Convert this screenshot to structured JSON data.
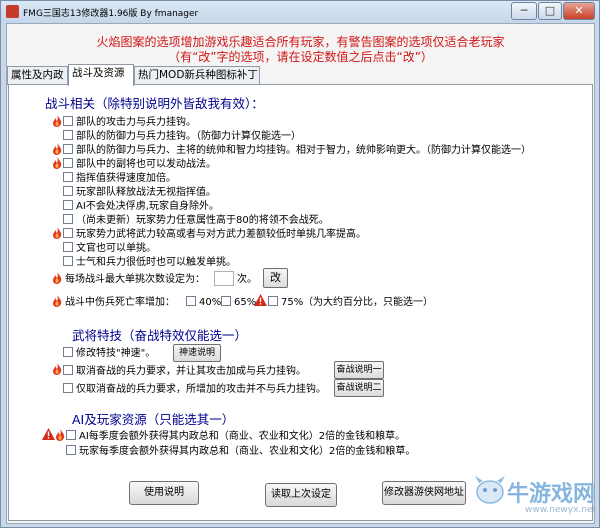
{
  "window": {
    "title": "FMG三国志13修改器1.96版 By fmanager",
    "min": "─",
    "max": "□",
    "close": "✕"
  },
  "warning": {
    "line1": "火焰图案的选项增加游戏乐趣适合所有玩家，有警告图案的选项仅适合老玩家",
    "line2": "（有“改”字的选项，请在设定数值之后点击“改”）"
  },
  "tabs": [
    "属性及内政",
    "战斗及资源",
    "热门MOD新兵种图标补丁"
  ],
  "battle": {
    "heading": "战斗相关（除特别说明外皆敌我有效）：",
    "items": [
      "部队的攻击力与兵力挂钩。",
      "部队的防御力与兵力挂钩。（防御力计算仅能选一）",
      "部队的防御力与兵力、主将的统帅和智力均挂钩。相对于智力，统帅影响更大。（防御力计算仅能选一）",
      "部队中的副将也可以发动战法。",
      "指挥值获得速度加倍。",
      "玩家部队释放战法无视指挥值。",
      "AI不会处决俘虏,玩家自身除外。",
      "（尚未更新）玩家势力任意属性高于80的将领不会战死。",
      "玩家势力武将武力较高或者与对方武力差额较低时单挑几率提高。",
      "文官也可以单挑。",
      "士气和兵力很低时也可以触发单挑。"
    ],
    "duel_label": "每场战斗最大单挑次数设定为：",
    "duel_value": "",
    "duel_unit": "次。",
    "duel_button": "改",
    "death_label": "战斗中伤兵死亡率增加：",
    "death_opts": [
      "40%",
      "65%",
      "75%"
    ],
    "death_note": "（为大约百分比，只能选一）"
  },
  "skill": {
    "heading": "武将特技（奋战特效仅能选一）",
    "item1": "修改特技\"神速\"。",
    "btn1": "神速说明",
    "item2": "取消奋战的兵力要求，并让其攻击加成与兵力挂钩。",
    "btn2": "奋战说明一",
    "item3": "仅取消奋战的兵力要求，所增加的攻击并不与兵力挂钩。",
    "btn3": "奋战说明二"
  },
  "ai": {
    "heading": "AI及玩家资源（只能选其一）",
    "item1": "AI每季度会额外获得其内政总和（商业、农业和文化）2倍的金钱和粮草。",
    "item2": "玩家每季度会额外获得其内政总和（商业、农业和文化）2倍的金钱和粮草。"
  },
  "bottom": {
    "help": "使用说明",
    "load": "读取上次设定",
    "site": "修改器游侠网地址"
  },
  "watermark": {
    "text": "牛游戏网",
    "url": "www.newyx.net"
  },
  "colors": {
    "warning_red": "#d21414",
    "heading_blue": "#000090",
    "fire": "#e23b22",
    "alert": "#d42a1c"
  }
}
